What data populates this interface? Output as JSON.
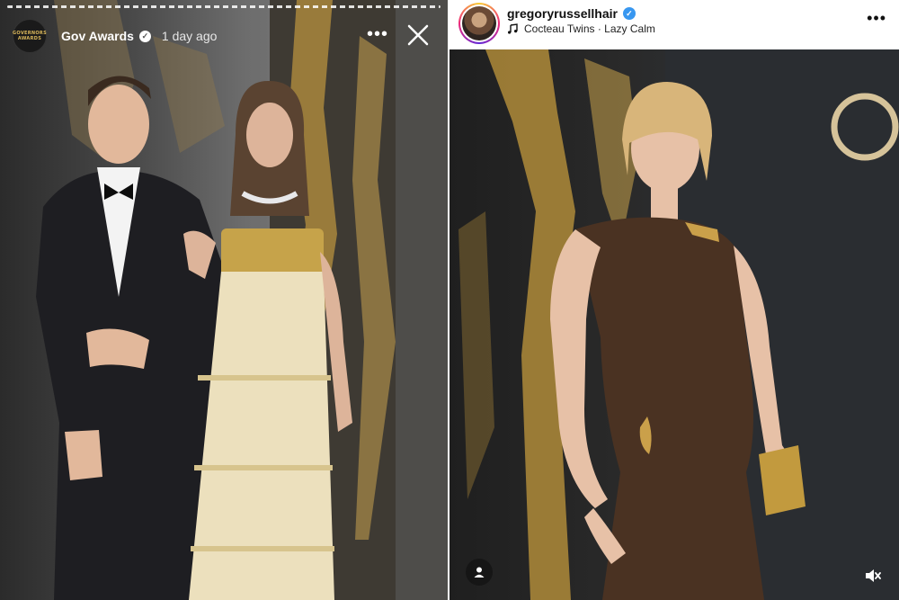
{
  "story": {
    "account_name": "Gov Awards",
    "time_ago": "1 day ago",
    "avatar_text_line1": "GOVERNORS",
    "avatar_text_line2": "AWARDS",
    "icons": {
      "more": "more-horizontal-icon",
      "close": "close-icon",
      "verified": "verified-badge-icon"
    }
  },
  "post": {
    "username": "gregoryrussellhair",
    "audio_artist": "Cocteau Twins",
    "audio_separator": " · ",
    "audio_track": "Lazy Calm",
    "icons": {
      "music": "music-note-icon",
      "more": "more-horizontal-icon",
      "tag": "user-tag-icon",
      "mute": "speaker-muted-icon",
      "verified": "verified-badge-icon"
    }
  },
  "colors": {
    "verified_blue": "#3897f0",
    "gold_accent": "#d9b65a",
    "story_ring": [
      "#f9ce34",
      "#ee2a7b",
      "#6228d7"
    ]
  }
}
